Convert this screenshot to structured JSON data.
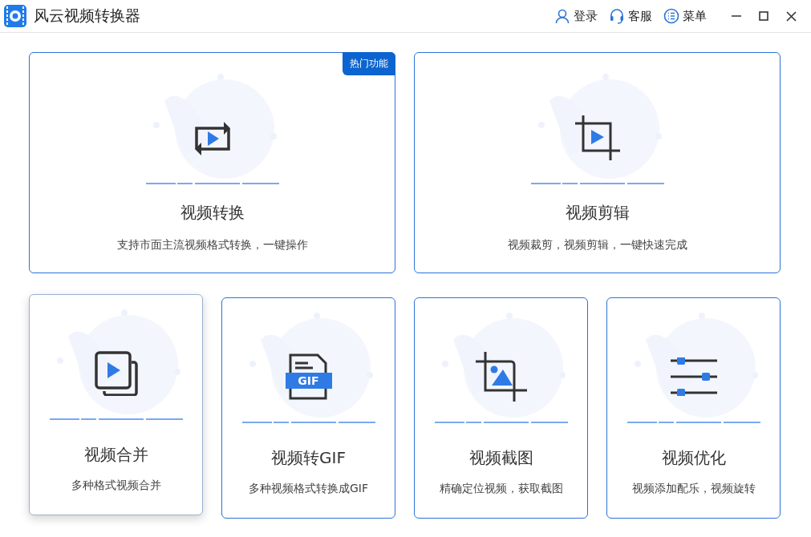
{
  "window": {
    "title": "风云视频转换器"
  },
  "header_actions": [
    {
      "kind": "user",
      "label": "登录"
    },
    {
      "kind": "headset",
      "label": "客服"
    },
    {
      "kind": "menu",
      "label": "菜单"
    }
  ],
  "window_controls": [
    {
      "kind": "minimize"
    },
    {
      "kind": "maximize"
    },
    {
      "kind": "close"
    }
  ],
  "large_cards": [
    {
      "kind": "convert",
      "title": "视频转换",
      "description": "支持市面主流视频格式转换，一键操作",
      "badge": "热门功能",
      "selected": false
    },
    {
      "kind": "edit",
      "title": "视频剪辑",
      "description": "视频裁剪，视频剪辑，一键快速完成",
      "selected": false
    }
  ],
  "small_cards": [
    {
      "kind": "merge",
      "title": "视频合并",
      "description": "多种格式视频合并",
      "selected": true
    },
    {
      "kind": "gif",
      "title": "视频转GIF",
      "description": "多种视频格式转换成GIF",
      "icon_label": "GIF",
      "selected": false
    },
    {
      "kind": "screenshot",
      "title": "视频截图",
      "description": "精确定位视频，获取截图",
      "selected": false
    },
    {
      "kind": "optimize",
      "title": "视频优化",
      "description": "视频添加配乐，视频旋转",
      "selected": false
    }
  ]
}
